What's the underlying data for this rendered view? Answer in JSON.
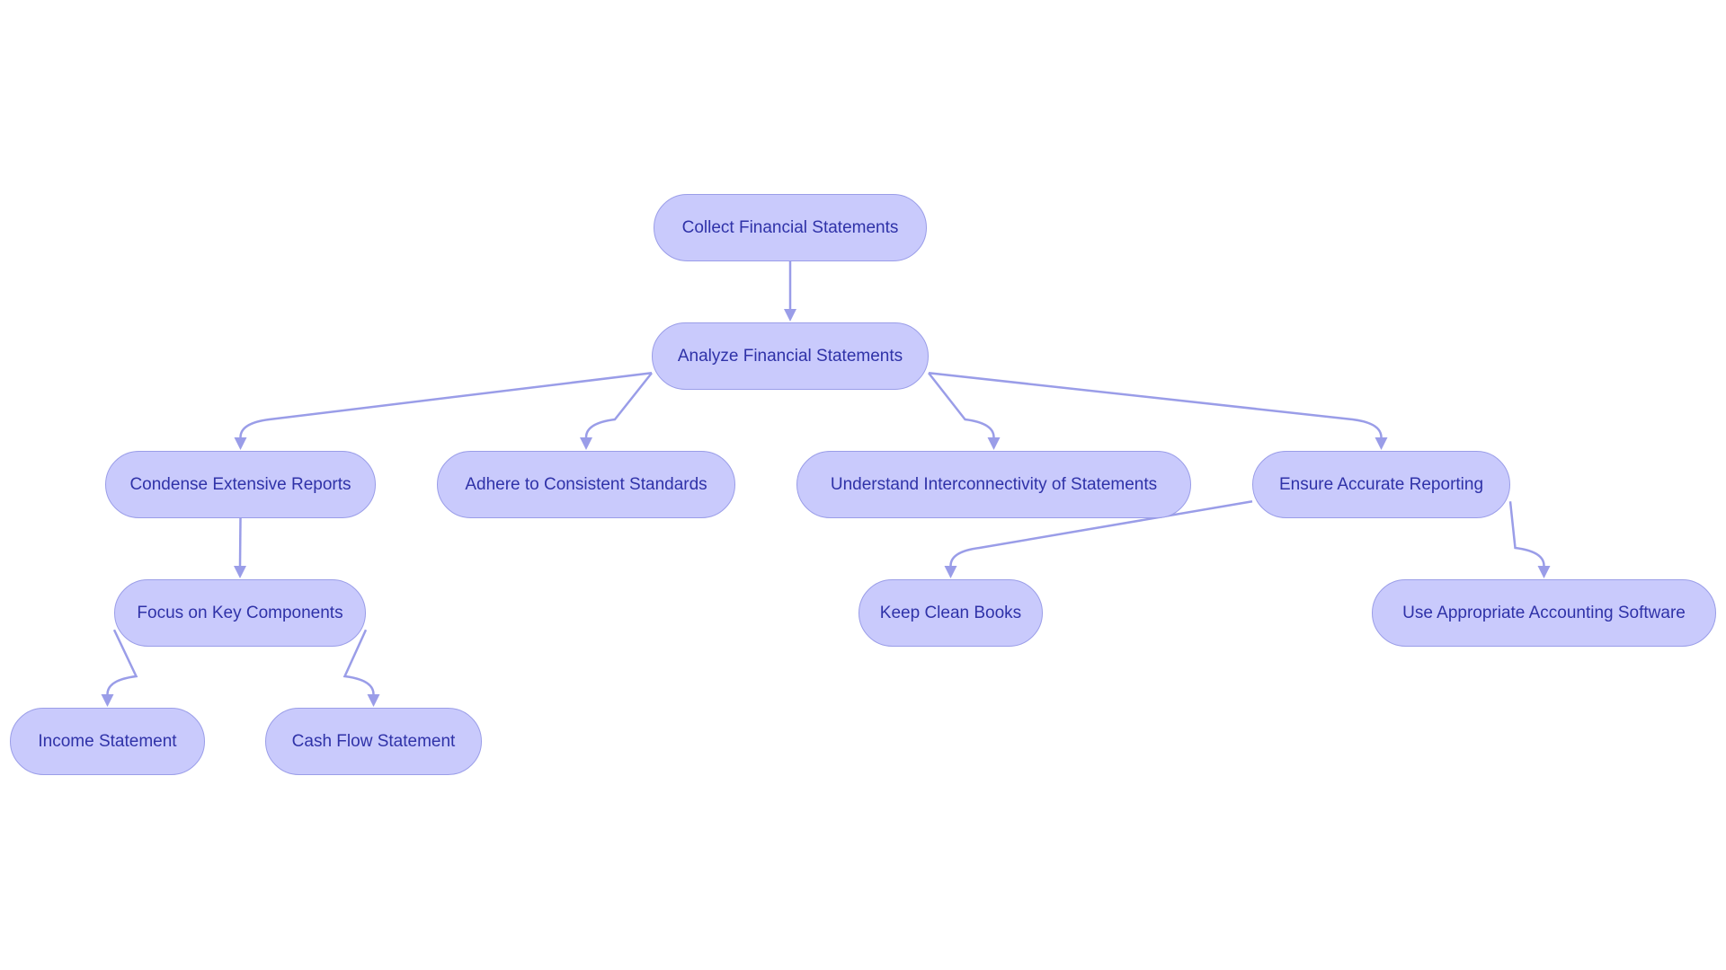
{
  "diagram": {
    "type": "flowchart",
    "direction": "top-down",
    "colors": {
      "node_fill": "#C9CAFC",
      "node_stroke": "#9A9DE8",
      "text": "#2F32A8",
      "edge": "#9A9DE8"
    },
    "nodes": [
      {
        "id": "collect",
        "label": "Collect Financial Statements"
      },
      {
        "id": "analyze",
        "label": "Analyze Financial Statements"
      },
      {
        "id": "condense",
        "label": "Condense Extensive Reports"
      },
      {
        "id": "adhere",
        "label": "Adhere to Consistent Standards"
      },
      {
        "id": "understand",
        "label": "Understand Interconnectivity of Statements"
      },
      {
        "id": "ensure",
        "label": "Ensure Accurate Reporting"
      },
      {
        "id": "focus",
        "label": "Focus on Key Components"
      },
      {
        "id": "keep",
        "label": "Keep Clean Books"
      },
      {
        "id": "software",
        "label": "Use Appropriate Accounting Software"
      },
      {
        "id": "income",
        "label": "Income Statement"
      },
      {
        "id": "cashflow",
        "label": "Cash Flow Statement"
      }
    ],
    "edges": [
      {
        "from": "collect",
        "to": "analyze"
      },
      {
        "from": "analyze",
        "to": "condense"
      },
      {
        "from": "analyze",
        "to": "adhere"
      },
      {
        "from": "analyze",
        "to": "understand"
      },
      {
        "from": "analyze",
        "to": "ensure"
      },
      {
        "from": "condense",
        "to": "focus"
      },
      {
        "from": "ensure",
        "to": "keep"
      },
      {
        "from": "ensure",
        "to": "software"
      },
      {
        "from": "focus",
        "to": "income"
      },
      {
        "from": "focus",
        "to": "cashflow"
      }
    ]
  }
}
